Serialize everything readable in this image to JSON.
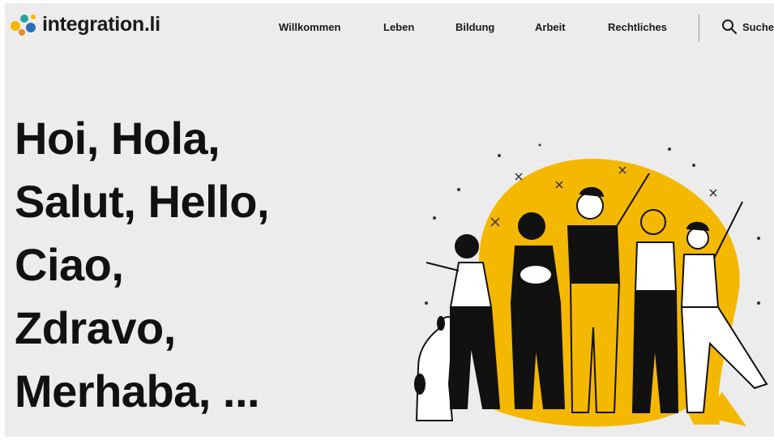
{
  "brand": {
    "name": "integration.li",
    "colors": {
      "yellow": "#f5b800",
      "blue": "#2a6fb5",
      "teal": "#2aa59a",
      "dark": "#111111"
    }
  },
  "nav": {
    "items": [
      {
        "label": "Willkommen"
      },
      {
        "label": "Leben"
      },
      {
        "label": "Bildung"
      },
      {
        "label": "Arbeit"
      },
      {
        "label": "Rechtliches"
      }
    ],
    "search_label": "Suche"
  },
  "hero": {
    "lines": [
      "Hoi, Hola,",
      "Salut, Hello,",
      "Ciao,",
      "Zdravo,",
      "Merhaba, ..."
    ]
  },
  "icons": {
    "search": "search-icon",
    "logo": "logo-mark-icon"
  }
}
